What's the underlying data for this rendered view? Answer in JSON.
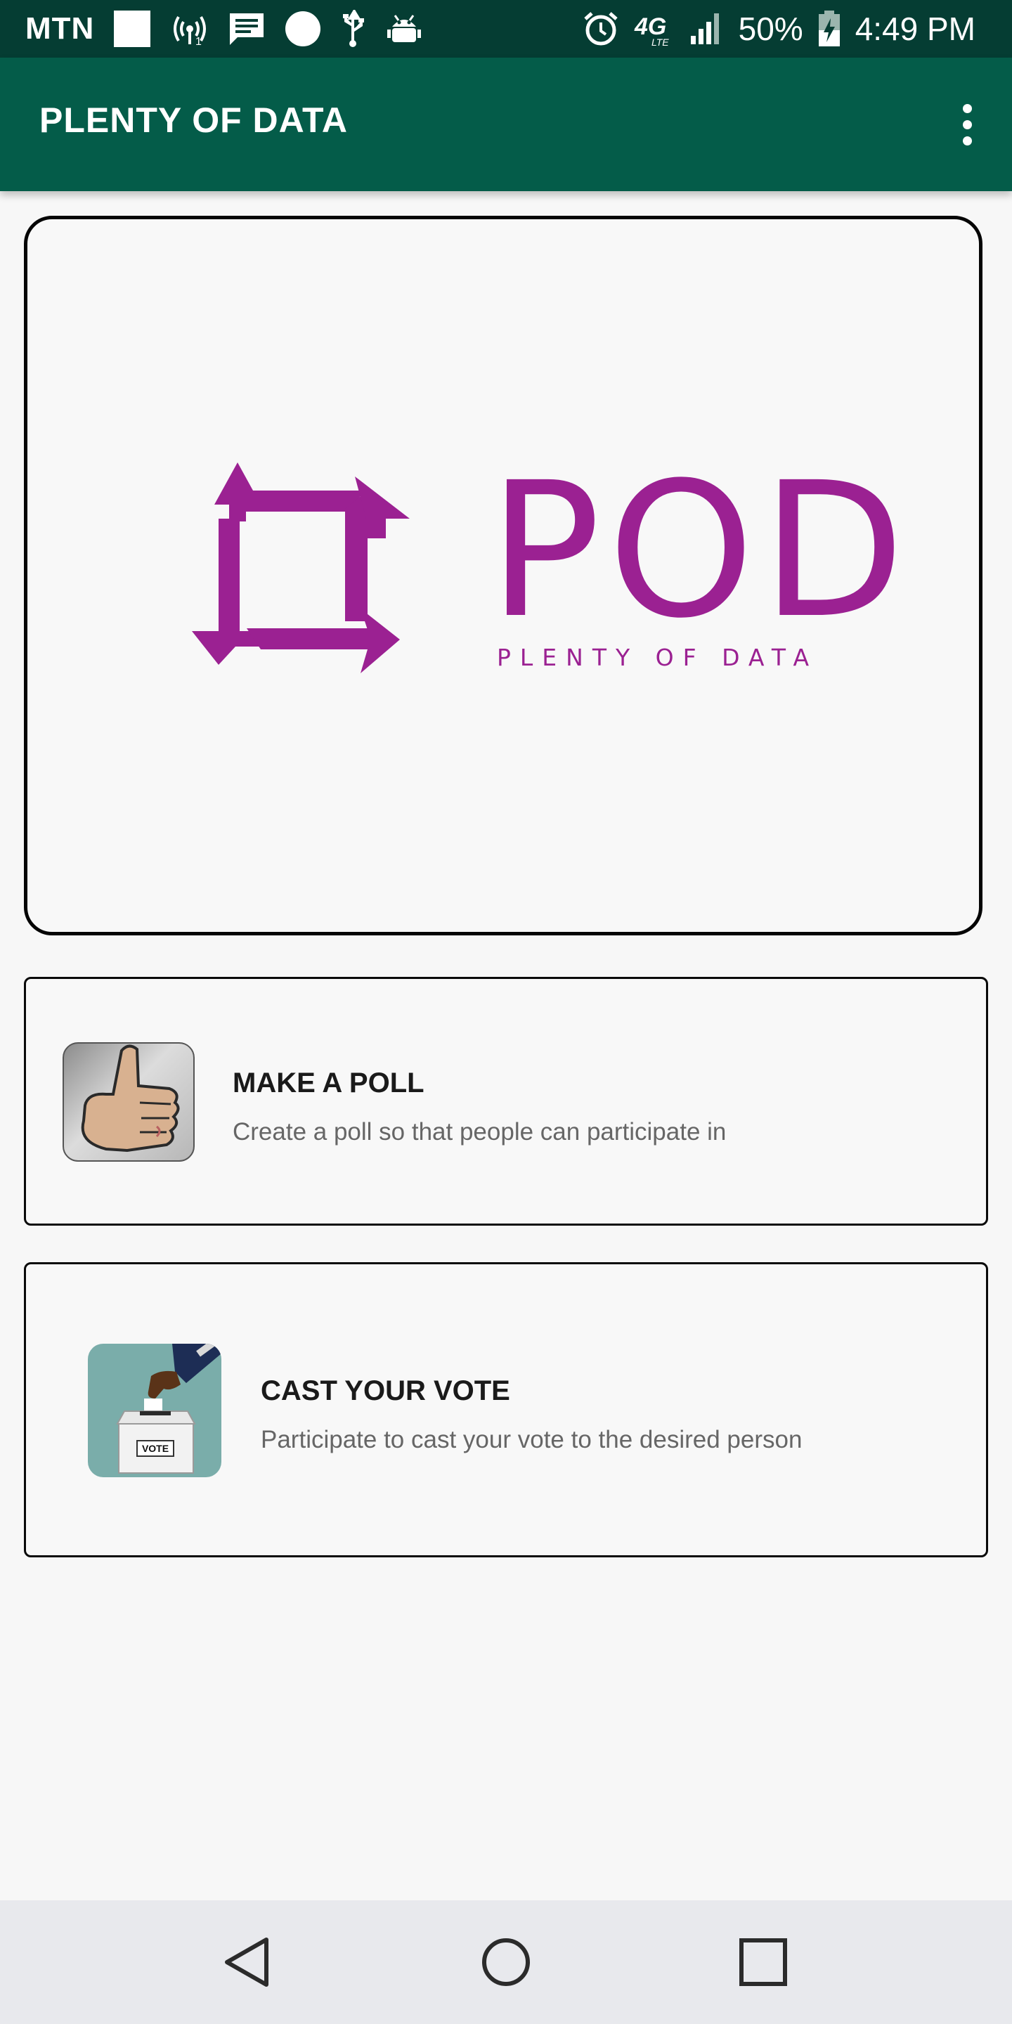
{
  "status_bar": {
    "carrier": "MTN",
    "battery": "50%",
    "time": "4:49 PM",
    "network": "4G",
    "network_sub": "LTE",
    "icons": [
      "sim-icon",
      "hotspot-icon",
      "message-icon",
      "circle-icon",
      "usb-icon",
      "android-debug-icon",
      "alarm-icon",
      "4g-lte-icon",
      "signal-icon",
      "battery-charging-icon"
    ]
  },
  "app_bar": {
    "title": "PLENTY OF DATA",
    "menu_icon": "more-vert-icon"
  },
  "logo": {
    "wordmark": "POD",
    "tagline": "PLENTY OF DATA",
    "color": "#9b2192"
  },
  "cards": [
    {
      "title": "MAKE A POLL",
      "description": "Create a poll so that people can participate in",
      "icon": "thumbs-up-icon"
    },
    {
      "title": "CAST YOUR VOTE",
      "description": "Participate to cast your vote to the desired person",
      "icon": "ballot-box-icon",
      "icon_label": "VOTE"
    }
  ],
  "nav_bar": {
    "icons": [
      "back-icon",
      "home-icon",
      "recents-icon"
    ]
  },
  "colors": {
    "status_bar": "#053d33",
    "app_bar": "#045c49",
    "background": "#f7f7f7",
    "nav_bar": "#e8e9ed"
  }
}
